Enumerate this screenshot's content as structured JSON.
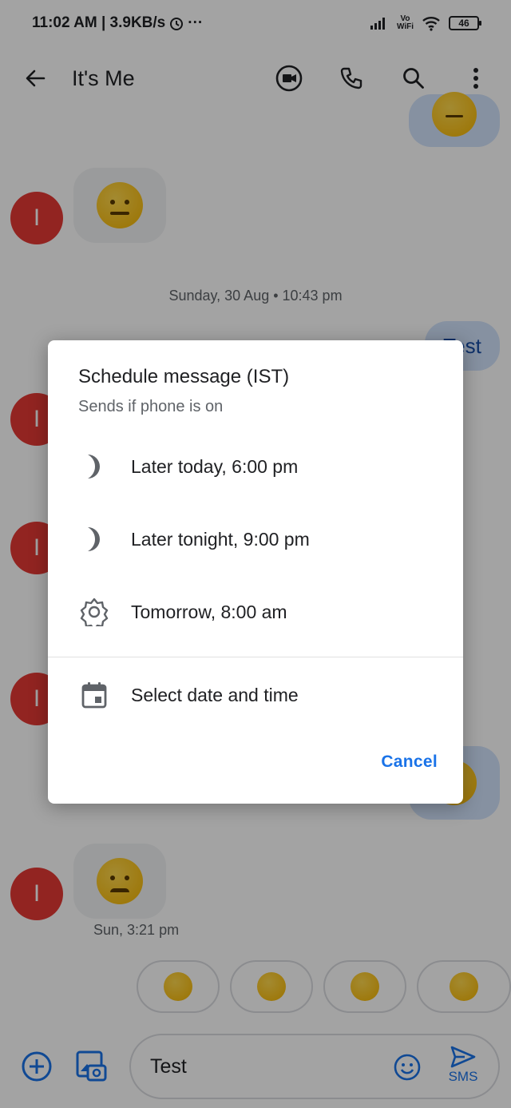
{
  "status_bar": {
    "time_speed": "11:02 AM | 3.9KB/s",
    "dots": "···",
    "vo": "Vo",
    "wifi": "WiFi",
    "battery": "46"
  },
  "app_bar": {
    "title": "It's Me"
  },
  "chat": {
    "avatar_initial": "I",
    "date_separator": "Sunday, 30 Aug • 10:43 pm",
    "outgoing_text": "Test",
    "last_message_time": "Sun, 3:21 pm"
  },
  "composer": {
    "input_value": "Test",
    "send_label": "SMS"
  },
  "dialog": {
    "title": "Schedule message (IST)",
    "subtitle": "Sends if phone is on",
    "options": [
      {
        "label": "Later today, 6:00 pm",
        "icon": "moon-icon"
      },
      {
        "label": "Later tonight, 9:00 pm",
        "icon": "moon-icon"
      },
      {
        "label": "Tomorrow, 8:00 am",
        "icon": "sun-icon"
      },
      {
        "label": "Select date and time",
        "icon": "calendar-icon"
      }
    ],
    "cancel_label": "Cancel"
  },
  "colors": {
    "accent": "#1a73e8",
    "avatar": "#e53935",
    "scrim": "rgba(0,0,0,0.36)"
  }
}
